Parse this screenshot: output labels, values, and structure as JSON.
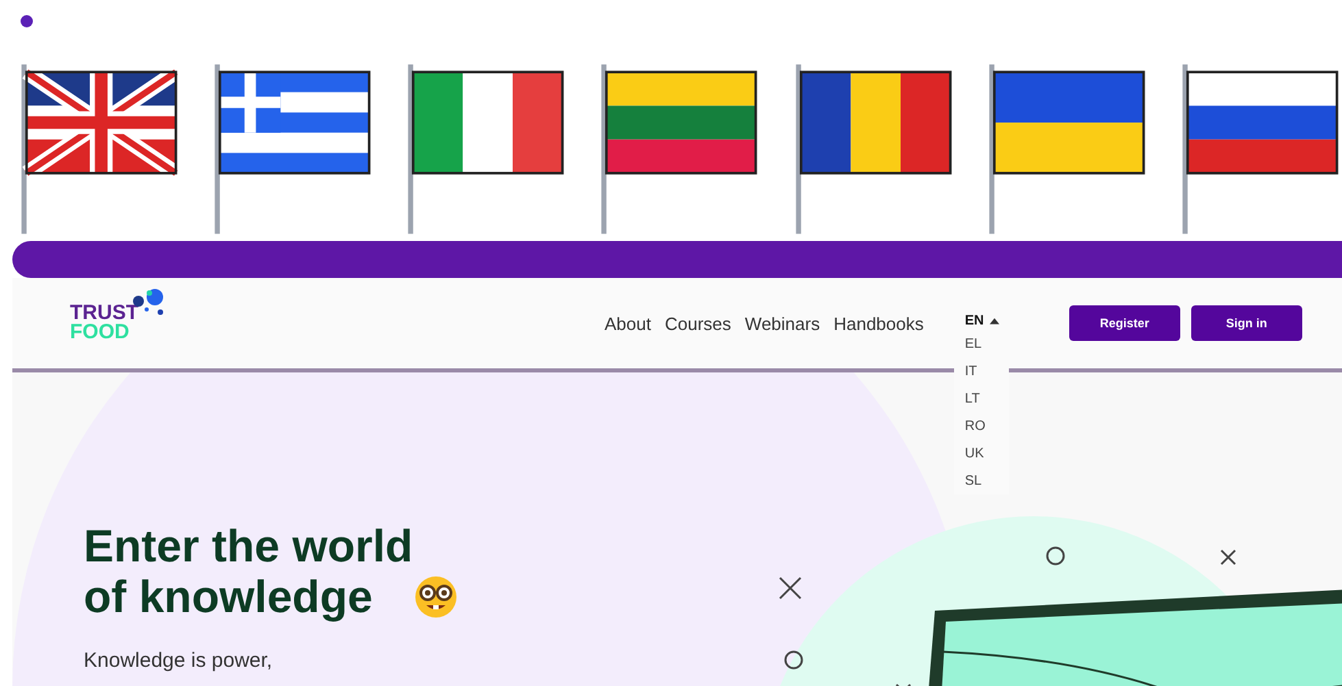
{
  "header": {
    "logo": {
      "line_1": "TRUST",
      "line_2": "FOOD"
    },
    "nav": [
      "About",
      "Courses",
      "Webinars",
      "Handbooks"
    ],
    "language_menu": {
      "expanded": true,
      "options": [
        {
          "label": "EN",
          "selected": true
        },
        {
          "label": "EL",
          "selected": false
        },
        {
          "label": "IT",
          "selected": false
        },
        {
          "label": "LT",
          "selected": false
        },
        {
          "label": "RO",
          "selected": false
        },
        {
          "label": "UK",
          "selected": false
        },
        {
          "label": "SL",
          "selected": false
        }
      ]
    },
    "buttons": [
      "Register",
      "Sign in"
    ]
  },
  "hero": {
    "title_line_1": "Enter the world",
    "title_line_2": "of knowledge",
    "text": "Knowledge is power,"
  }
}
